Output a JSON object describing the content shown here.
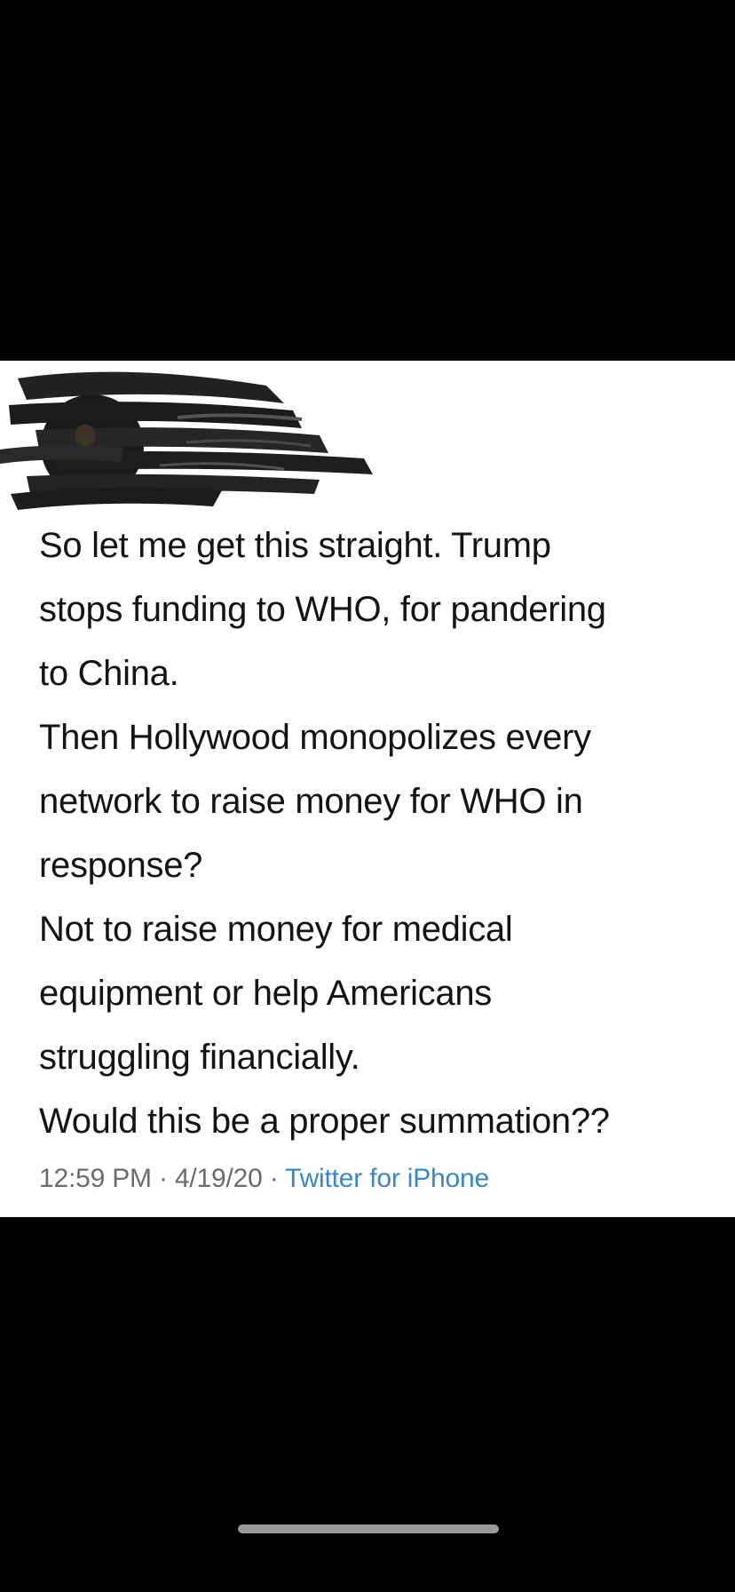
{
  "tweet": {
    "lines": [
      "So let me get this straight. Trump",
      "stops funding to WHO, for pandering",
      "to China.",
      "Then Hollywood monopolizes every",
      "network to raise money for WHO in",
      "response?",
      "Not to raise money for medical",
      "equipment or help Americans",
      "struggling financially.",
      "Would this be a proper summation??"
    ],
    "time": "12:59 PM",
    "separator": "·",
    "date": "4/19/20",
    "source": "Twitter for iPhone"
  },
  "icons": {
    "redaction": "scribble-redaction-icon",
    "home_indicator": "home-indicator-bar"
  },
  "colors": {
    "background": "#000000",
    "card": "#ffffff",
    "text": "#141414",
    "meta": "#6b6b6b",
    "link": "#3a86c8"
  }
}
